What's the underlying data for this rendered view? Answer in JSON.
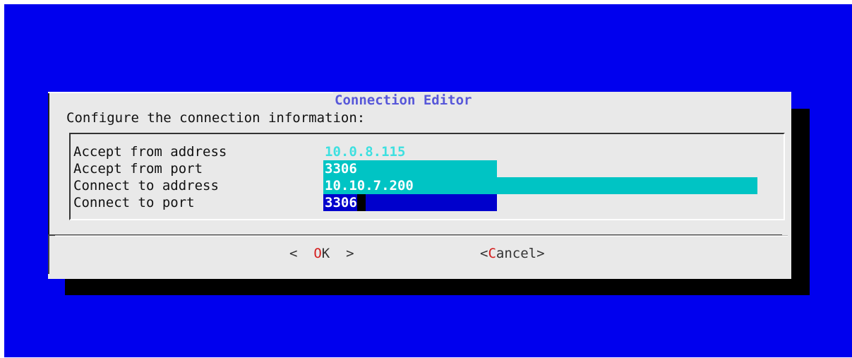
{
  "dialog": {
    "title": "Connection Editor",
    "prompt": "Configure the connection information:"
  },
  "form": {
    "fields": [
      {
        "label": "Accept from address",
        "value": "10.0.8.115"
      },
      {
        "label": "Accept from port",
        "value": "3306"
      },
      {
        "label": "Connect to address",
        "value": "10.10.7.200"
      },
      {
        "label": "Connect to port",
        "value": "3306"
      }
    ]
  },
  "buttons": {
    "ok": {
      "left": "<  ",
      "hot": "O",
      "rest": "K",
      "right": "  >"
    },
    "cancel": {
      "left": "<",
      "hot": "C",
      "rest": "ancel",
      "right": ">"
    }
  },
  "colors": {
    "background": "#0000ee",
    "dialog": "#e9e9e9",
    "title": "#5757d9",
    "field_active": "#00c4c4",
    "field_focused": "#0000cc",
    "hotkey": "#d41c1c"
  }
}
